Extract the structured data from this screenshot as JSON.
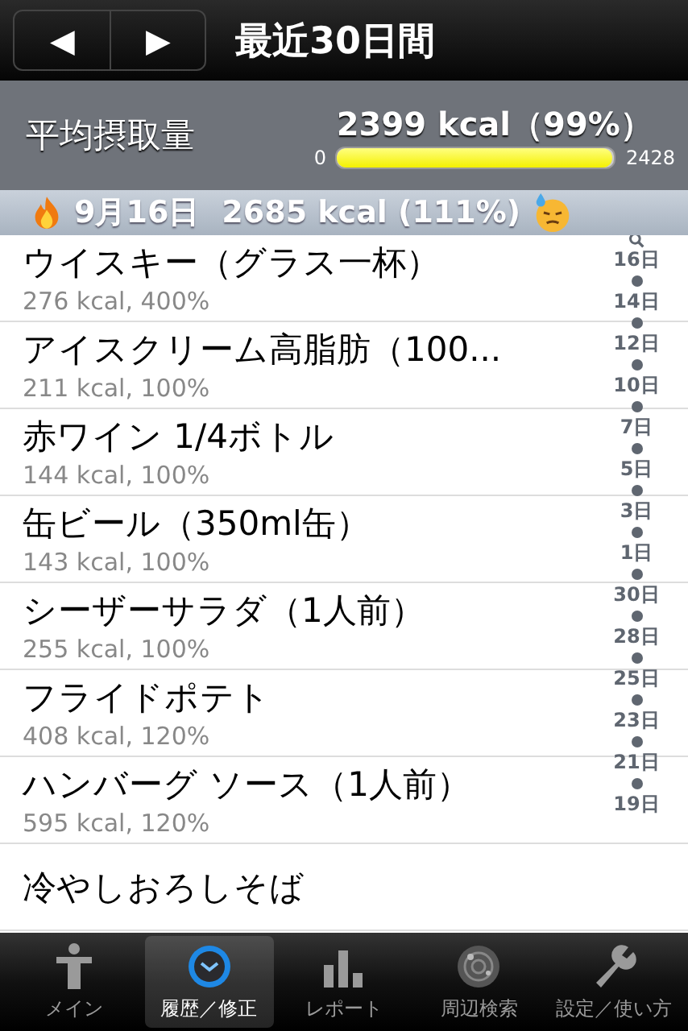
{
  "nav": {
    "prev": "◀",
    "next": "▶",
    "title": "最近30日間"
  },
  "summary": {
    "label": "平均摂取量",
    "value": "2399 kcal（99%）",
    "min": "0",
    "max": "2428",
    "level": 0.99
  },
  "day_header": {
    "date": "9月16日",
    "total": "2685 kcal (111%)"
  },
  "entries": [
    {
      "name": "ウイスキー（グラス一杯）",
      "detail": "276 kcal, 400%"
    },
    {
      "name": "アイスクリーム高脂肪（100...",
      "detail": "211 kcal, 100%"
    },
    {
      "name": "赤ワイン 1/4ボトル",
      "detail": "144 kcal, 100%"
    },
    {
      "name": "缶ビール（350ml缶）",
      "detail": "143 kcal, 100%"
    },
    {
      "name": "シーザーサラダ（1人前）",
      "detail": "255 kcal, 100%"
    },
    {
      "name": "フライドポテト",
      "detail": "408 kcal, 120%"
    },
    {
      "name": "ハンバーグ ソース（1人前）",
      "detail": "595 kcal, 120%"
    },
    {
      "name": "冷やしおろしそば"
    }
  ],
  "index": [
    "16日",
    "14日",
    "12日",
    "10日",
    "7日",
    "5日",
    "3日",
    "1日",
    "30日",
    "28日",
    "25日",
    "23日",
    "21日",
    "19日"
  ],
  "tabs": [
    {
      "label": "メイン",
      "kind": "person",
      "selected": false
    },
    {
      "label": "履歴／修正",
      "kind": "clock",
      "selected": true
    },
    {
      "label": "レポート",
      "kind": "chart",
      "selected": false
    },
    {
      "label": "周辺検索",
      "kind": "radar",
      "selected": false
    },
    {
      "label": "設定／使い方",
      "kind": "wrench",
      "selected": false
    }
  ]
}
